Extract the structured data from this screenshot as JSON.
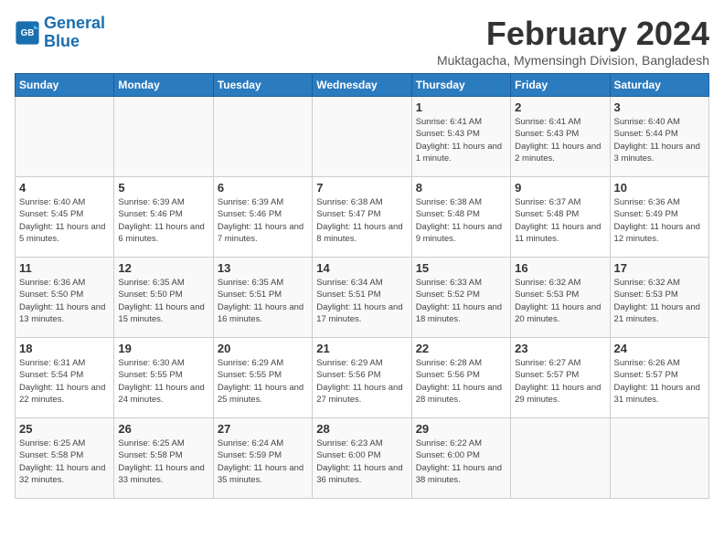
{
  "logo": {
    "line1": "General",
    "line2": "Blue"
  },
  "title": "February 2024",
  "location": "Muktagacha, Mymensingh Division, Bangladesh",
  "weekdays": [
    "Sunday",
    "Monday",
    "Tuesday",
    "Wednesday",
    "Thursday",
    "Friday",
    "Saturday"
  ],
  "weeks": [
    [
      {
        "day": "",
        "sunrise": "",
        "sunset": "",
        "daylight": ""
      },
      {
        "day": "",
        "sunrise": "",
        "sunset": "",
        "daylight": ""
      },
      {
        "day": "",
        "sunrise": "",
        "sunset": "",
        "daylight": ""
      },
      {
        "day": "",
        "sunrise": "",
        "sunset": "",
        "daylight": ""
      },
      {
        "day": "1",
        "sunrise": "Sunrise: 6:41 AM",
        "sunset": "Sunset: 5:43 PM",
        "daylight": "Daylight: 11 hours and 1 minute."
      },
      {
        "day": "2",
        "sunrise": "Sunrise: 6:41 AM",
        "sunset": "Sunset: 5:43 PM",
        "daylight": "Daylight: 11 hours and 2 minutes."
      },
      {
        "day": "3",
        "sunrise": "Sunrise: 6:40 AM",
        "sunset": "Sunset: 5:44 PM",
        "daylight": "Daylight: 11 hours and 3 minutes."
      }
    ],
    [
      {
        "day": "4",
        "sunrise": "Sunrise: 6:40 AM",
        "sunset": "Sunset: 5:45 PM",
        "daylight": "Daylight: 11 hours and 5 minutes."
      },
      {
        "day": "5",
        "sunrise": "Sunrise: 6:39 AM",
        "sunset": "Sunset: 5:46 PM",
        "daylight": "Daylight: 11 hours and 6 minutes."
      },
      {
        "day": "6",
        "sunrise": "Sunrise: 6:39 AM",
        "sunset": "Sunset: 5:46 PM",
        "daylight": "Daylight: 11 hours and 7 minutes."
      },
      {
        "day": "7",
        "sunrise": "Sunrise: 6:38 AM",
        "sunset": "Sunset: 5:47 PM",
        "daylight": "Daylight: 11 hours and 8 minutes."
      },
      {
        "day": "8",
        "sunrise": "Sunrise: 6:38 AM",
        "sunset": "Sunset: 5:48 PM",
        "daylight": "Daylight: 11 hours and 9 minutes."
      },
      {
        "day": "9",
        "sunrise": "Sunrise: 6:37 AM",
        "sunset": "Sunset: 5:48 PM",
        "daylight": "Daylight: 11 hours and 11 minutes."
      },
      {
        "day": "10",
        "sunrise": "Sunrise: 6:36 AM",
        "sunset": "Sunset: 5:49 PM",
        "daylight": "Daylight: 11 hours and 12 minutes."
      }
    ],
    [
      {
        "day": "11",
        "sunrise": "Sunrise: 6:36 AM",
        "sunset": "Sunset: 5:50 PM",
        "daylight": "Daylight: 11 hours and 13 minutes."
      },
      {
        "day": "12",
        "sunrise": "Sunrise: 6:35 AM",
        "sunset": "Sunset: 5:50 PM",
        "daylight": "Daylight: 11 hours and 15 minutes."
      },
      {
        "day": "13",
        "sunrise": "Sunrise: 6:35 AM",
        "sunset": "Sunset: 5:51 PM",
        "daylight": "Daylight: 11 hours and 16 minutes."
      },
      {
        "day": "14",
        "sunrise": "Sunrise: 6:34 AM",
        "sunset": "Sunset: 5:51 PM",
        "daylight": "Daylight: 11 hours and 17 minutes."
      },
      {
        "day": "15",
        "sunrise": "Sunrise: 6:33 AM",
        "sunset": "Sunset: 5:52 PM",
        "daylight": "Daylight: 11 hours and 18 minutes."
      },
      {
        "day": "16",
        "sunrise": "Sunrise: 6:32 AM",
        "sunset": "Sunset: 5:53 PM",
        "daylight": "Daylight: 11 hours and 20 minutes."
      },
      {
        "day": "17",
        "sunrise": "Sunrise: 6:32 AM",
        "sunset": "Sunset: 5:53 PM",
        "daylight": "Daylight: 11 hours and 21 minutes."
      }
    ],
    [
      {
        "day": "18",
        "sunrise": "Sunrise: 6:31 AM",
        "sunset": "Sunset: 5:54 PM",
        "daylight": "Daylight: 11 hours and 22 minutes."
      },
      {
        "day": "19",
        "sunrise": "Sunrise: 6:30 AM",
        "sunset": "Sunset: 5:55 PM",
        "daylight": "Daylight: 11 hours and 24 minutes."
      },
      {
        "day": "20",
        "sunrise": "Sunrise: 6:29 AM",
        "sunset": "Sunset: 5:55 PM",
        "daylight": "Daylight: 11 hours and 25 minutes."
      },
      {
        "day": "21",
        "sunrise": "Sunrise: 6:29 AM",
        "sunset": "Sunset: 5:56 PM",
        "daylight": "Daylight: 11 hours and 27 minutes."
      },
      {
        "day": "22",
        "sunrise": "Sunrise: 6:28 AM",
        "sunset": "Sunset: 5:56 PM",
        "daylight": "Daylight: 11 hours and 28 minutes."
      },
      {
        "day": "23",
        "sunrise": "Sunrise: 6:27 AM",
        "sunset": "Sunset: 5:57 PM",
        "daylight": "Daylight: 11 hours and 29 minutes."
      },
      {
        "day": "24",
        "sunrise": "Sunrise: 6:26 AM",
        "sunset": "Sunset: 5:57 PM",
        "daylight": "Daylight: 11 hours and 31 minutes."
      }
    ],
    [
      {
        "day": "25",
        "sunrise": "Sunrise: 6:25 AM",
        "sunset": "Sunset: 5:58 PM",
        "daylight": "Daylight: 11 hours and 32 minutes."
      },
      {
        "day": "26",
        "sunrise": "Sunrise: 6:25 AM",
        "sunset": "Sunset: 5:58 PM",
        "daylight": "Daylight: 11 hours and 33 minutes."
      },
      {
        "day": "27",
        "sunrise": "Sunrise: 6:24 AM",
        "sunset": "Sunset: 5:59 PM",
        "daylight": "Daylight: 11 hours and 35 minutes."
      },
      {
        "day": "28",
        "sunrise": "Sunrise: 6:23 AM",
        "sunset": "Sunset: 6:00 PM",
        "daylight": "Daylight: 11 hours and 36 minutes."
      },
      {
        "day": "29",
        "sunrise": "Sunrise: 6:22 AM",
        "sunset": "Sunset: 6:00 PM",
        "daylight": "Daylight: 11 hours and 38 minutes."
      },
      {
        "day": "",
        "sunrise": "",
        "sunset": "",
        "daylight": ""
      },
      {
        "day": "",
        "sunrise": "",
        "sunset": "",
        "daylight": ""
      }
    ]
  ]
}
